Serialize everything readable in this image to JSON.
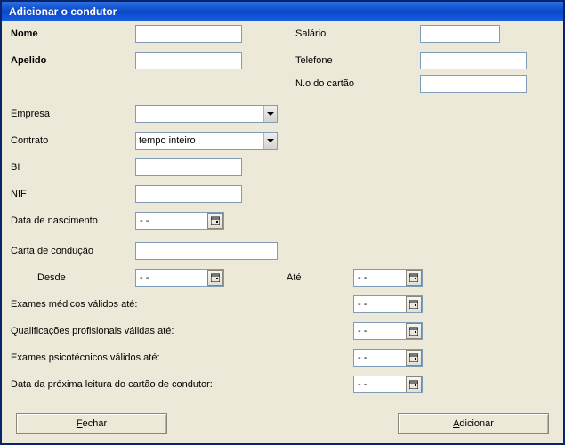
{
  "title": "Adicionar o condutor",
  "labels": {
    "nome": "Nome",
    "apelido": "Apelido",
    "salario": "Salário",
    "telefone": "Telefone",
    "num_cartao": "N.o do cartão",
    "empresa": "Empresa",
    "contrato": "Contrato",
    "bi": "BI",
    "nif": "NIF",
    "data_nascimento": "Data de nascimento",
    "carta": "Carta de condução",
    "desde": "Desde",
    "ate": "Até",
    "exames_medicos": "Exames médicos válidos até:",
    "qualificacoes": "Qualificações profisionais válidas até:",
    "psicotecnicos": "Exames psicotécnicos válidos até:",
    "prox_leitura": "Data da próxima leitura do cartão de condutor:"
  },
  "values": {
    "nome": "",
    "apelido": "",
    "salario": "",
    "telefone": "",
    "num_cartao": "",
    "empresa": "",
    "contrato": "tempo inteiro",
    "bi": "",
    "nif": "",
    "data_nascimento": " -  - ",
    "carta": "",
    "desde": " -  - ",
    "ate": " -  - ",
    "exames_medicos": " -  - ",
    "qualificacoes": " -  - ",
    "psicotecnicos": " -  - ",
    "prox_leitura": " -  - "
  },
  "buttons": {
    "fechar_u": "F",
    "fechar_rest": "echar",
    "adicionar_u": "A",
    "adicionar_rest": "dicionar"
  }
}
